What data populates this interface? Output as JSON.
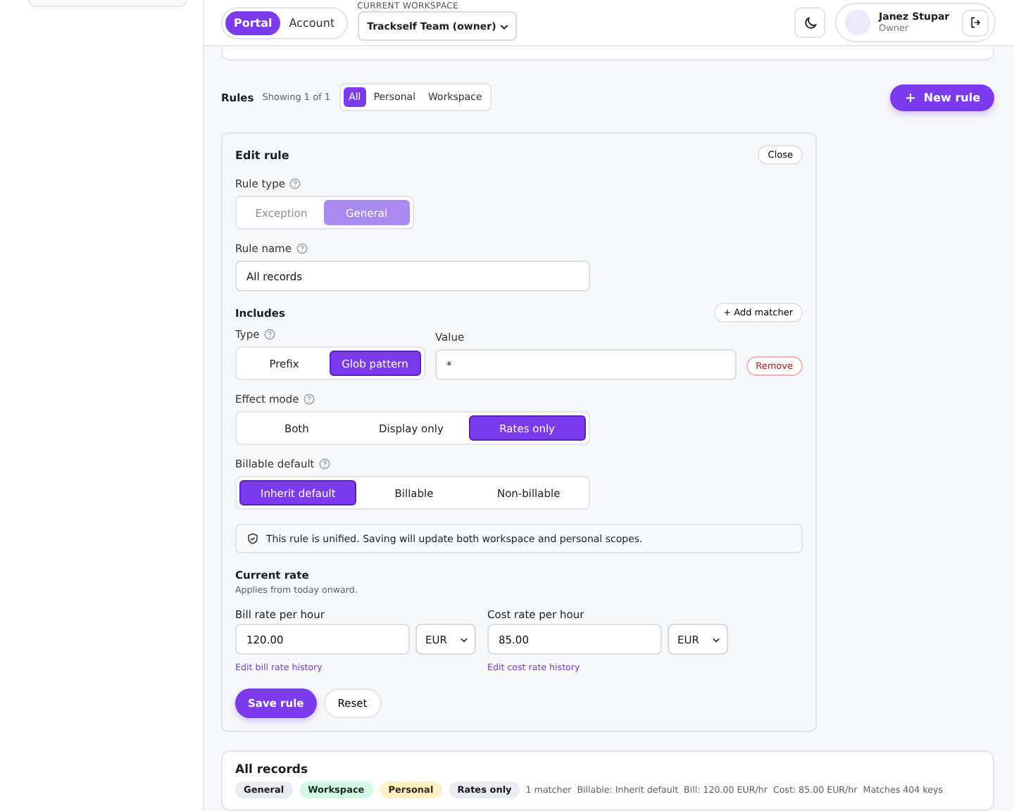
{
  "header": {
    "segments": [
      {
        "label": "Portal",
        "selected": true
      },
      {
        "label": "Account",
        "selected": false
      }
    ],
    "workspace": {
      "label": "CURRENT WORKSPACE",
      "value": "Trackself Team (owner)"
    },
    "user": {
      "name": "Janez Stupar",
      "role": "Owner"
    }
  },
  "rules": {
    "title": "Rules",
    "count": "Showing 1 of 1",
    "filters": [
      {
        "label": "All",
        "selected": true
      },
      {
        "label": "Personal",
        "selected": false
      },
      {
        "label": "Workspace",
        "selected": false
      }
    ],
    "new_button": "New rule"
  },
  "editor": {
    "title": "Edit rule",
    "close": "Close",
    "rule_type": {
      "label": "Rule type",
      "disabled": true,
      "options": [
        {
          "label": "Exception",
          "selected": false
        },
        {
          "label": "General",
          "selected": true
        }
      ]
    },
    "rule_name": {
      "label": "Rule name",
      "value": "All records"
    },
    "includes": {
      "title": "Includes",
      "add": "+ Add matcher"
    },
    "matcher": {
      "type_label": "Type",
      "options": [
        {
          "label": "Prefix",
          "selected": false
        },
        {
          "label": "Glob pattern",
          "selected": true
        }
      ],
      "value_label": "Value",
      "value": "*",
      "remove": "Remove"
    },
    "effect_mode": {
      "label": "Effect mode",
      "options": [
        {
          "label": "Both",
          "selected": false
        },
        {
          "label": "Display only",
          "selected": false
        },
        {
          "label": "Rates only",
          "selected": true
        }
      ]
    },
    "billable_default": {
      "label": "Billable default",
      "options": [
        {
          "label": "Inherit default",
          "selected": true
        },
        {
          "label": "Billable",
          "selected": false
        },
        {
          "label": "Non-billable",
          "selected": false
        }
      ]
    },
    "notice": "This rule is unified. Saving will update both workspace and personal scopes.",
    "current_rate": {
      "title": "Current rate",
      "note": "Applies from today onward."
    },
    "rates": [
      {
        "label": "Bill rate per hour",
        "value": "120.00",
        "currency": "EUR",
        "link": "Edit bill rate history"
      },
      {
        "label": "Cost rate per hour",
        "value": "85.00",
        "currency": "EUR",
        "link": "Edit cost rate history"
      }
    ],
    "save": "Save rule",
    "reset": "Reset"
  },
  "summary": {
    "title": "All records",
    "tags": [
      {
        "label": "General",
        "color": "#e8edf5"
      },
      {
        "label": "Workspace",
        "color": "#d1fae5"
      },
      {
        "label": "Personal",
        "color": "#fdf0c4"
      },
      {
        "label": "Rates only",
        "color": "#e8edf5"
      }
    ],
    "meta": [
      "1 matcher",
      "Billable: Inherit default",
      "Bill: 120.00 EUR/hr",
      "Cost: 85.00 EUR/hr",
      "Matches 404 keys"
    ]
  }
}
